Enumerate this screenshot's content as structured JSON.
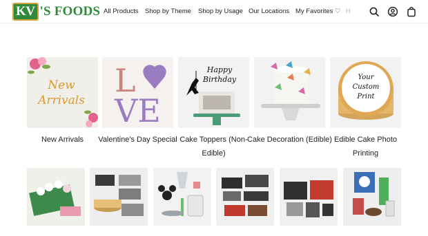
{
  "brand": {
    "badge": "KV",
    "name": "'S FOODS",
    "green": "#2f8a3a",
    "gold": "#d3a23b"
  },
  "nav": {
    "items": [
      {
        "label": "All Products"
      },
      {
        "label": "Shop by Theme"
      },
      {
        "label": "Shop by Usage"
      },
      {
        "label": "Our Locations"
      },
      {
        "label": "My Favorites ♡"
      },
      {
        "label": "H"
      }
    ]
  },
  "header_icons": [
    "search-icon",
    "account-icon",
    "cart-icon"
  ],
  "categories": [
    {
      "label": "New Arrivals",
      "thumb_text": [
        "New",
        "Arrivals"
      ]
    },
    {
      "label": "Valentine's Day Special",
      "thumb_text": [
        "L",
        "VE"
      ]
    },
    {
      "label": "Cake Toppers (Non-Edible)",
      "thumb_text": [
        "Happy",
        "Birthday"
      ]
    },
    {
      "label": "Cake Decoration (Edible)"
    },
    {
      "label": "Edible Cake Photo Printing",
      "thumb_text": [
        "Your",
        "Custom",
        "Print"
      ]
    }
  ]
}
